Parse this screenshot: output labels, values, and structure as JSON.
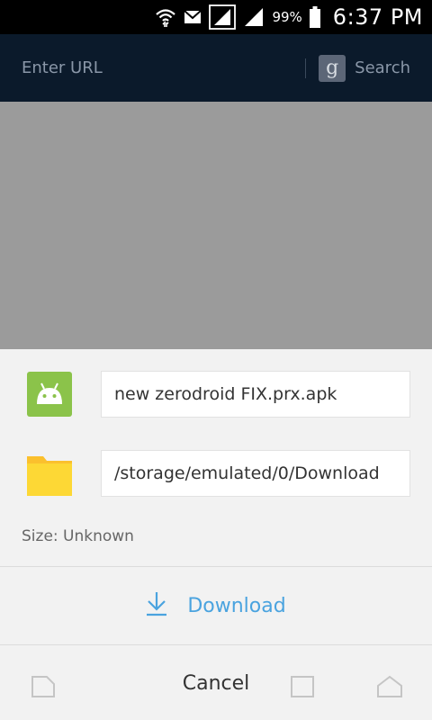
{
  "status_bar": {
    "battery_percent": "99%",
    "time": "6:37 PM",
    "icons": [
      "wifi-icon",
      "mail-icon",
      "signal-icon",
      "signal-icon-2",
      "battery-icon"
    ]
  },
  "browser": {
    "url_placeholder": "Enter URL",
    "search_icon": "google-g-icon",
    "search_icon_letter": "g",
    "search_label": "Search"
  },
  "download_dialog": {
    "file_name": "new zerodroid FIX.prx.apk",
    "file_path": "/storage/emulated/0/Download",
    "size_text": "Size: Unknown",
    "download_label": "Download",
    "cancel_label": "Cancel",
    "file_icon": "android-icon",
    "folder_icon": "folder-icon",
    "download_icon": "download-arrow-icon"
  },
  "colors": {
    "url_bar_bg": "#0b1a2b",
    "content_bg": "#9b9b9b",
    "accent_blue": "#4aa3df",
    "android_green": "#8bc34a",
    "folder_yellow": "#fbc02d"
  }
}
